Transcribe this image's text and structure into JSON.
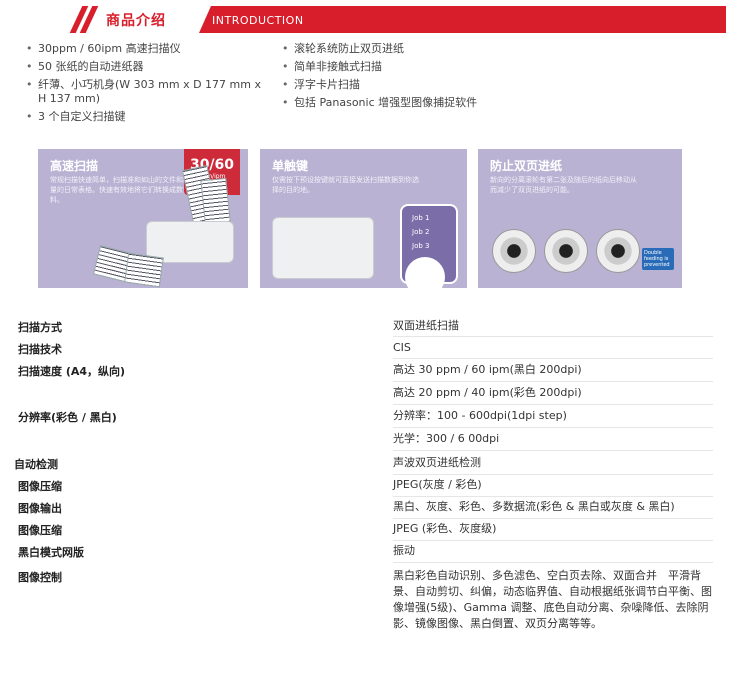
{
  "header": {
    "title_cn": "商品介绍",
    "title_en": "INTRODUCTION",
    "accent_color": "#d91e2b"
  },
  "features": {
    "left": [
      "30ppm / 60ipm 高速扫描仪",
      "50 张纸的自动进纸器",
      "纤薄、小巧机身(W 303 mm x D 177 mm x H 137 mm)",
      "3 个自定义扫描键"
    ],
    "right": [
      "滚轮系统防止双页进纸",
      "简单非接触式扫描",
      "浮字卡片扫描",
      "包括 Panasonic 增强型图像捕捉软件"
    ]
  },
  "panels": [
    {
      "title": "高速扫描",
      "desc": "常规扫描快速简单，扫描准和如山的文件和和大量的日常表格。快速有效地将它们转换成数字资料。",
      "badge_value": "30/60",
      "badge_unit": "ppm/ipm"
    },
    {
      "title": "单触键",
      "desc": "仅需按下预设按键就可直接发送扫描数据到你选择的目的地。",
      "jobs": [
        "Job 1",
        "Job 2",
        "Job 3"
      ]
    },
    {
      "title": "防止双页进纸",
      "desc": "新向的分离滚轮有第二张及随后的纸向后移动从而减少了双页进纸的可能。",
      "tag": "Double feeding is prevented"
    }
  ],
  "specs": [
    {
      "label": "扫描方式",
      "values": [
        "双面进纸扫描"
      ]
    },
    {
      "label": "扫描技术",
      "values": [
        "CIS"
      ]
    },
    {
      "label": "扫描速度 (A4，纵向)",
      "values": [
        "高达 30 ppm / 60 ipm(黑白 200dpi)",
        "高达 20 ppm / 40 ipm(彩色 200dpi)"
      ]
    },
    {
      "label": "分辨率(彩色 / 黑白)",
      "values": [
        "分辨率：100 - 600dpi(1dpi step)",
        "光学：300 / 6 00dpi"
      ]
    },
    {
      "label": "自动检测",
      "values": [
        "声波双页进纸检测"
      ]
    },
    {
      "label": "图像压缩",
      "values": [
        "JPEG(灰度 / 彩色)"
      ]
    },
    {
      "label": "图像输出",
      "values": [
        "黑白、灰度、彩色、多数据流(彩色 & 黑白或灰度 & 黑白)"
      ]
    },
    {
      "label": "图像压缩",
      "values": [
        "JPEG (彩色、灰度级)"
      ]
    },
    {
      "label": "黑白模式网版",
      "values": [
        "振动"
      ]
    },
    {
      "label": "图像控制",
      "values": [
        "黑白彩色自动识别、多色滤色、空白页去除、双面合并　平滑背景、自动剪切、纠偏，动态临界值、自动根据纸张调节白平衡、图像增强(5级)、Gamma 调整、底色自动分离、杂噪降低、去除阴影、镜像图像、黑白倒置、双页分离等等。"
      ]
    }
  ]
}
